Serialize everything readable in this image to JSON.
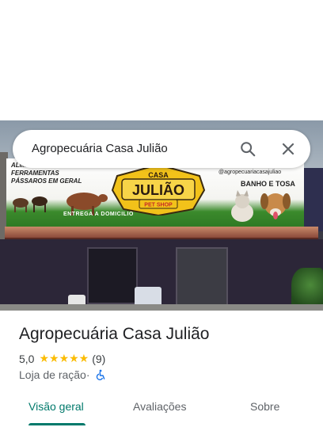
{
  "search": {
    "query": "Agropecuária Casa Julião"
  },
  "icons": {
    "search": "search-icon",
    "close": "close-icon",
    "accessibility": "wheelchair-icon"
  },
  "photo": {
    "banner_list": [
      "ALIMENTOS",
      "FERRAMENTAS",
      "PÁSSAROS EM GERAL"
    ],
    "logo_line1": "CASA",
    "logo_line2": "JULIÃO",
    "logo_line3": "PET SHOP",
    "handle": "@agropecuariacasajuliao",
    "service": "BANHO E TOSA",
    "delivery": "ENTREGA A DOMICILIO"
  },
  "place": {
    "name": "Agropecuária Casa Julião",
    "rating": "5,0",
    "stars": "★★★★★",
    "review_count": "(9)",
    "category": "Loja de ração",
    "separator": " · "
  },
  "tabs": [
    {
      "label": "Visão geral",
      "active": true
    },
    {
      "label": "Avaliações",
      "active": false
    },
    {
      "label": "Sobre",
      "active": false
    }
  ],
  "colors": {
    "accent": "#00796b",
    "star": "#fbbc04",
    "accessibility": "#1a73e8"
  }
}
